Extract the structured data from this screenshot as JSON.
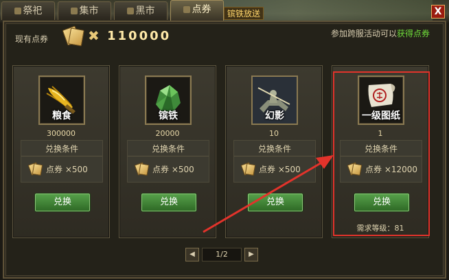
{
  "tabs": [
    {
      "label": "祭祀",
      "active": false
    },
    {
      "label": "集市",
      "active": false
    },
    {
      "label": "黑市",
      "active": false
    },
    {
      "label": "点券",
      "active": true
    }
  ],
  "scene_banner": "镔铁放送",
  "close_label": "X",
  "points": {
    "label": "现有点券",
    "multiplier": "✖",
    "value": "110000"
  },
  "hint": {
    "prefix": "参加跨服活动可以",
    "highlight": "获得点券"
  },
  "items": [
    {
      "name": "粮食",
      "count": "300000",
      "condition_title": "兑换条件",
      "cost": "点券 ×500",
      "button": "兑换",
      "icon": "grain-icon"
    },
    {
      "name": "镔铁",
      "count": "20000",
      "condition_title": "兑换条件",
      "cost": "点券 ×500",
      "button": "兑换",
      "icon": "ore-icon"
    },
    {
      "name": "幻影",
      "count": "10",
      "condition_title": "兑换条件",
      "cost": "点券 ×500",
      "button": "兑换",
      "icon": "phantom-rider-icon"
    },
    {
      "name": "一级图纸",
      "count": "1",
      "condition_title": "兑换条件",
      "cost": "点券 ×12000",
      "button": "兑换",
      "icon": "scroll-icon",
      "required_level": "需求等级：81"
    }
  ],
  "pager": {
    "prev": "◀",
    "page": "1/2",
    "next": "▶"
  },
  "colors": {
    "accent_green": "#6fdc3a",
    "highlight_red": "#e2332b",
    "button_green": "#3f8a34"
  }
}
